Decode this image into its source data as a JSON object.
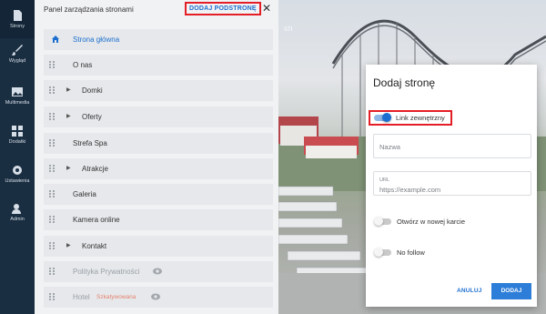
{
  "nav": {
    "items": [
      {
        "label": "Strony",
        "icon": "file-icon"
      },
      {
        "label": "Wygląd",
        "icon": "brush-icon"
      },
      {
        "label": "Multimedia",
        "icon": "image-icon"
      },
      {
        "label": "Dodatki",
        "icon": "grid-icon"
      },
      {
        "label": "Ustawienia",
        "icon": "gear-icon"
      },
      {
        "label": "Admin",
        "icon": "user-icon"
      }
    ]
  },
  "panel": {
    "title": "Panel zarządzania stronami",
    "add_label": "DODAJ PODSTRONĘ",
    "close_glyph": "✕",
    "home_label": "Strona główna",
    "pages": [
      {
        "label": "O nas"
      },
      {
        "label": "Domki"
      },
      {
        "label": "Oferty"
      },
      {
        "label": "Strefa Spa"
      },
      {
        "label": "Atrakcje"
      },
      {
        "label": "Galeria"
      },
      {
        "label": "Kamera online"
      },
      {
        "label": "Kontakt"
      },
      {
        "label": "Polityka Prywatności"
      },
      {
        "label": "Hotel",
        "badge": "Szkatywowana"
      }
    ]
  },
  "background": {
    "text": "STI"
  },
  "dialog": {
    "title": "Dodaj stronę",
    "external_link_label": "Link zewnętrzny",
    "name_placeholder": "Nazwa",
    "url_label": "URL",
    "url_placeholder": "https://example.com",
    "new_tab_label": "Otwórz w nowej karcie",
    "nofollow_label": "No follow",
    "cancel_label": "ANULUJ",
    "submit_label": "DODAJ"
  },
  "colors": {
    "accent": "#1d6fcf",
    "highlight": "#e41e26",
    "nav_bg": "#1a2e42"
  }
}
